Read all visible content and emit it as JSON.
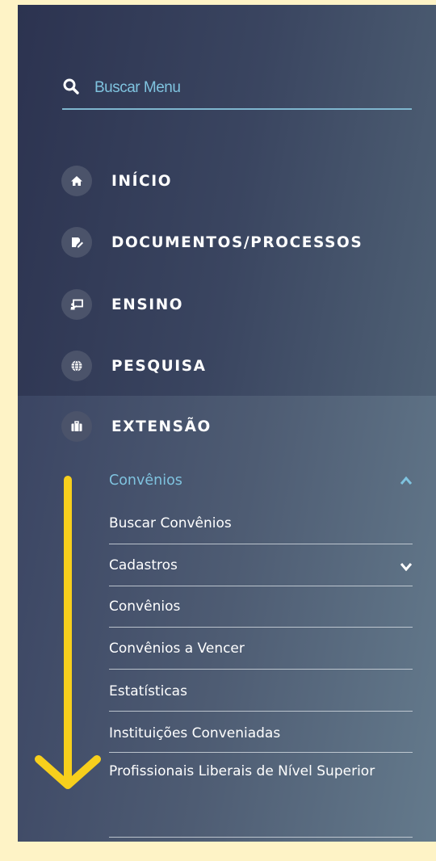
{
  "search": {
    "placeholder": "Buscar Menu",
    "icon": "search-icon"
  },
  "menu": {
    "items": [
      {
        "label": "INÍCIO",
        "icon": "home-icon"
      },
      {
        "label": "DOCUMENTOS/PROCESSOS",
        "icon": "document-edit-icon"
      },
      {
        "label": "ENSINO",
        "icon": "presentation-icon"
      },
      {
        "label": "PESQUISA",
        "icon": "globe-icon"
      },
      {
        "label": "EXTENSÃO",
        "icon": "briefcase-icon"
      }
    ],
    "active_index": 4,
    "submenu": {
      "header": "Convênios",
      "header_expanded": true,
      "items": [
        {
          "label": "Buscar Convênios"
        },
        {
          "label": "Cadastros",
          "has_children": true
        },
        {
          "label": "Convênios"
        },
        {
          "label": "Convênios a Vencer"
        },
        {
          "label": "Estatísticas"
        },
        {
          "label": "Instituições Conveniadas"
        },
        {
          "label": "Profissionais Liberais de Nível Superior"
        }
      ]
    }
  },
  "colors": {
    "page_bg": "#fef3c6",
    "sidebar_dark": "#2c3350",
    "accent": "#7fc3df",
    "annotation_arrow": "#f7cf1c"
  },
  "annotation": {
    "type": "scroll-down-arrow"
  }
}
